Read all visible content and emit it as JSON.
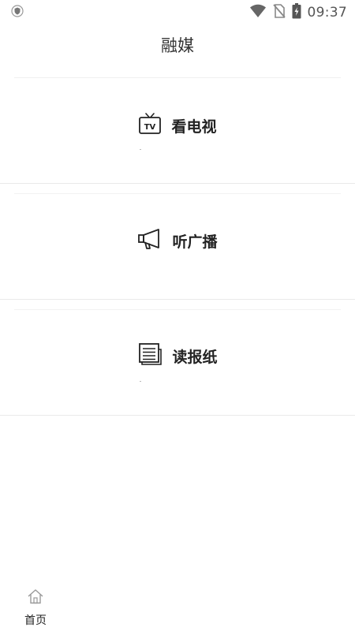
{
  "status_bar": {
    "time": "09:37",
    "icons": [
      "shield-icon",
      "wifi-icon",
      "no-sim-icon",
      "battery-charging-icon"
    ]
  },
  "header": {
    "title": "融媒"
  },
  "cards": [
    {
      "label": "看电视",
      "icon": "tv-icon"
    },
    {
      "label": "听广播",
      "icon": "megaphone-icon"
    },
    {
      "label": "读报纸",
      "icon": "newspaper-icon"
    }
  ],
  "bottom_nav": {
    "items": [
      {
        "label": "首页",
        "icon": "home-icon"
      }
    ]
  }
}
